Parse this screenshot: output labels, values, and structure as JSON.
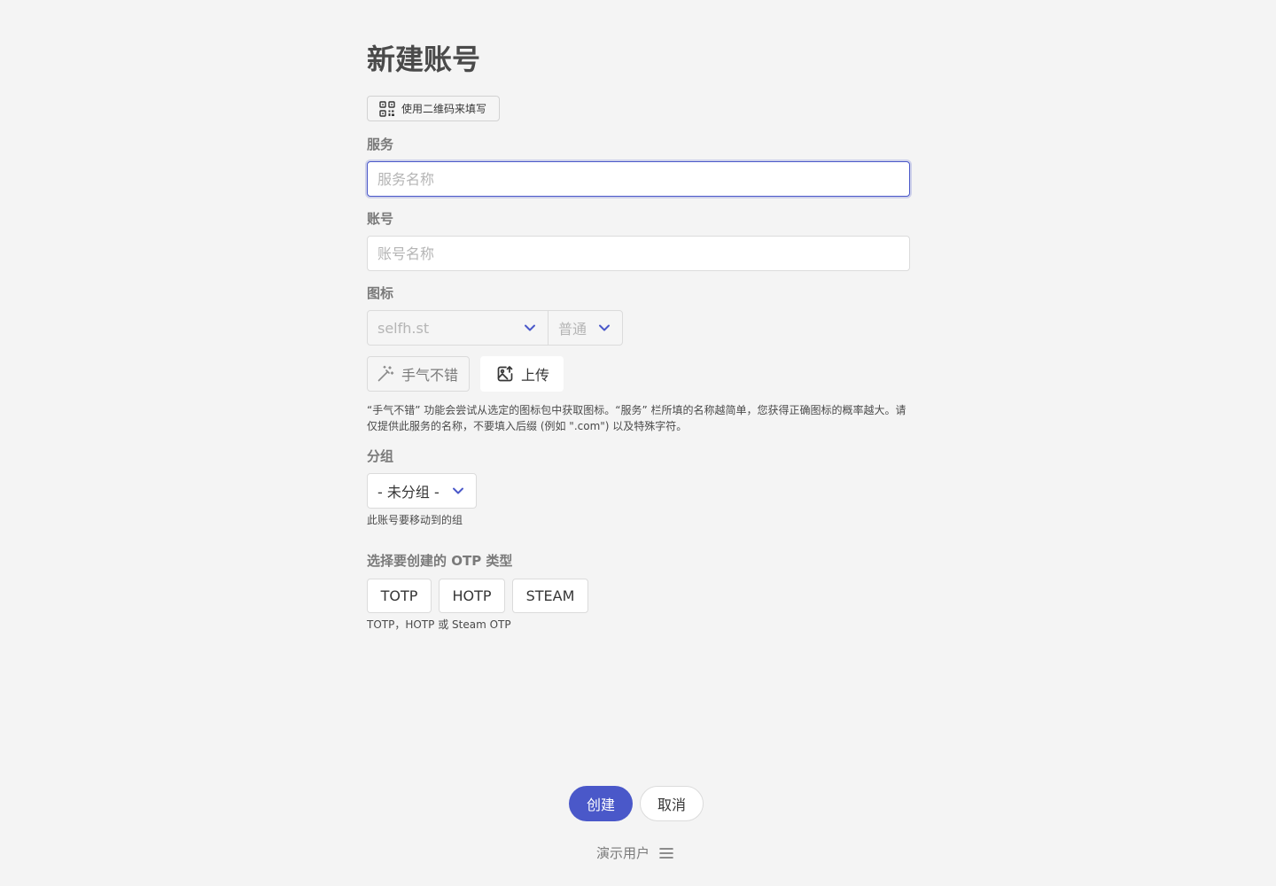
{
  "page": {
    "title": "新建账号",
    "qr_button_label": "使用二维码来填写"
  },
  "service": {
    "label": "服务",
    "placeholder": "服务名称",
    "value": ""
  },
  "account": {
    "label": "账号",
    "placeholder": "账号名称",
    "value": ""
  },
  "icon": {
    "label": "图标",
    "iconpack_select": "selfh.st",
    "variant_select": "普通",
    "lucky_button": "手气不错",
    "upload_button": "上传",
    "help_text": "“手气不错” 功能会尝试从选定的图标包中获取图标。“服务” 栏所填的名称越简单，您获得正确图标的概率越大。请仅提供此服务的名称，不要填入后缀 (例如 \".com\") 以及特殊字符。"
  },
  "group": {
    "label": "分组",
    "selected": "- 未分组 -",
    "help_text": "此账号要移动到的组"
  },
  "otp_type": {
    "label": "选择要创建的 OTP 类型",
    "options": [
      "TOTP",
      "HOTP",
      "STEAM"
    ],
    "help_text": "TOTP，HOTP 或 Steam OTP"
  },
  "footer": {
    "create_button": "创建",
    "cancel_button": "取消",
    "user_label": "演示用户"
  },
  "colors": {
    "accent": "#4a58c9",
    "background": "#f4f4f4"
  },
  "icons": [
    "qr-code-icon",
    "chevron-down-icon",
    "magic-wand-icon",
    "image-upload-icon",
    "hamburger-menu-icon"
  ]
}
